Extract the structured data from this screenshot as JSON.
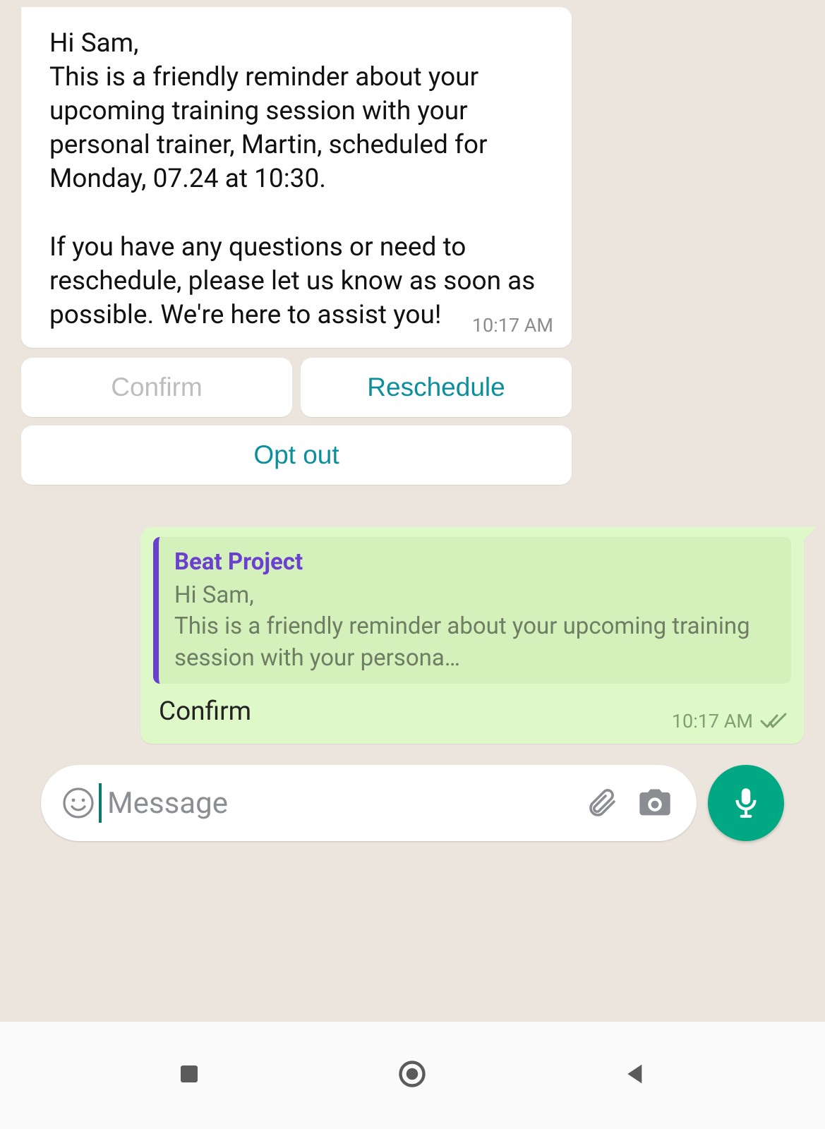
{
  "colors": {
    "accent_teal": "#0b8f9c",
    "quote_purple": "#6b3fcf",
    "mic_green": "#00a884",
    "outgoing_bg": "#dff8c8"
  },
  "incoming": {
    "text": "Hi Sam,\nThis is a friendly reminder about your upcoming training session with your personal trainer, Martin, scheduled for Monday, 07.24 at 10:30.\n\nIf you have any questions or need to reschedule, please let us know as soon as possible. We're here to assist you!",
    "time": "10:17 AM"
  },
  "quick_replies": {
    "confirm": "Confirm",
    "reschedule": "Reschedule",
    "opt_out": "Opt out"
  },
  "outgoing": {
    "quote_sender": "Beat Project",
    "quote_text": "Hi Sam,\nThis is a friendly reminder about your upcoming training session with your persona…",
    "body": "Confirm",
    "time": "10:17 AM"
  },
  "composer": {
    "placeholder": "Message"
  },
  "icons": {
    "emoji": "emoji-icon",
    "attachment": "attachment-icon",
    "camera": "camera-icon",
    "mic": "mic-icon",
    "recents": "android-recents-icon",
    "home": "android-home-icon",
    "back": "android-back-icon",
    "double_check": "read-ticks-icon"
  }
}
